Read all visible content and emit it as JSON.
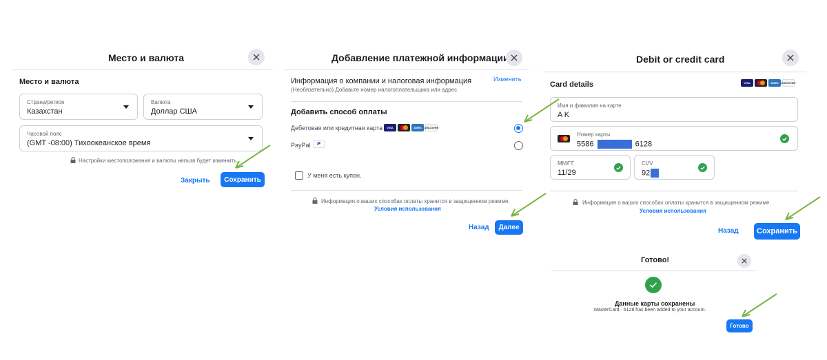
{
  "panel1": {
    "title": "Место и валюта",
    "section": "Место и валюта",
    "country": {
      "label": "Страна/регион",
      "value": "Казахстан"
    },
    "currency": {
      "label": "Валюта",
      "value": "Доллар США"
    },
    "timezone": {
      "label": "Часовой пояс",
      "value": "(GMT -08:00) Тихоокеанское время"
    },
    "note": "Настройки местоположения и валюты нельзя будет изменить.",
    "close_label": "Закрыть",
    "save_label": "Сохранить"
  },
  "panel2": {
    "title": "Добавление платежной информации",
    "company_heading": "Информация о компании и налоговая информация",
    "company_sub": "(Необязательно) Добавьте номер налогоплательщика или адрес",
    "edit_label": "Изменить",
    "method_heading": "Добавить способ оплаты",
    "card_option": "Дебетовая или кредитная карта",
    "paypal_option": "PayPal",
    "coupon_label": "У меня есть купон.",
    "secure_note": "Информация о ваших способах оплаты хранится в защищенном режиме.",
    "terms_link": "Условия использования",
    "back_label": "Назад",
    "next_label": "Далее"
  },
  "panel3": {
    "title": "Debit or credit card",
    "card_details": "Card details",
    "name_field": {
      "label": "Имя и фамилия на карте",
      "value": "A K"
    },
    "number_field": {
      "label": "Номер карты",
      "prefix": "5586",
      "suffix": "6128"
    },
    "expiry_field": {
      "label": "ММ/ГГ",
      "value": "11/29"
    },
    "cvv_field": {
      "label": "CVV",
      "value": "92"
    },
    "secure_note": "Информация о ваших способах оплаты хранится в защищенном режиме.",
    "terms_link": "Условия использования",
    "back_label": "Назад",
    "save_label": "Сохранить"
  },
  "panel4": {
    "title": "Готово!",
    "heading": "Данные карты сохранены",
    "message": "MasterCard · 6128 has been added to your account.",
    "done_label": "Готово"
  },
  "card_brands": [
    "VISA",
    "MasterCard",
    "AMEX",
    "DISCOVER"
  ],
  "colors": {
    "accent": "#1877f2",
    "success": "#31a24c",
    "arrow": "#7cb342",
    "redaction": "#3b6fd8"
  }
}
